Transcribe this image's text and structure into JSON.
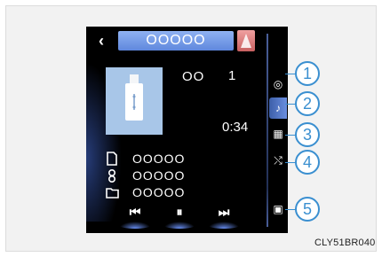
{
  "header": {
    "back_glyph": "‹",
    "title": "OOOOO"
  },
  "now_playing": {
    "source_icon": "usb-drive-icon",
    "track_label": "OO",
    "track_number": "1",
    "elapsed_time": "0:34"
  },
  "info": [
    {
      "icon": "file-icon",
      "text": "OOOOO"
    },
    {
      "icon": "artist-icon",
      "text": "OOOOO"
    },
    {
      "icon": "folder-icon",
      "text": "OOOOO"
    }
  ],
  "controls": {
    "prev": "⏮",
    "pause": "⏸",
    "next": "⏭"
  },
  "side_menu": [
    {
      "icon": "source-icon",
      "glyph": "◎",
      "active": false
    },
    {
      "icon": "music-note-icon",
      "glyph": "♪",
      "active": true
    },
    {
      "icon": "sound-settings-icon",
      "glyph": "▦",
      "active": false
    },
    {
      "icon": "climate-icon",
      "glyph": "⤭",
      "active": false
    },
    {
      "icon": "screen-icon",
      "glyph": "▣",
      "active": false
    }
  ],
  "callouts": [
    "1",
    "2",
    "3",
    "4",
    "5"
  ],
  "caption": "CLY51BR040",
  "colors": {
    "accent": "#3a8fd0",
    "title_pill": "#6f95e3",
    "screen_bg": "#000000",
    "alert": "#d87878"
  }
}
